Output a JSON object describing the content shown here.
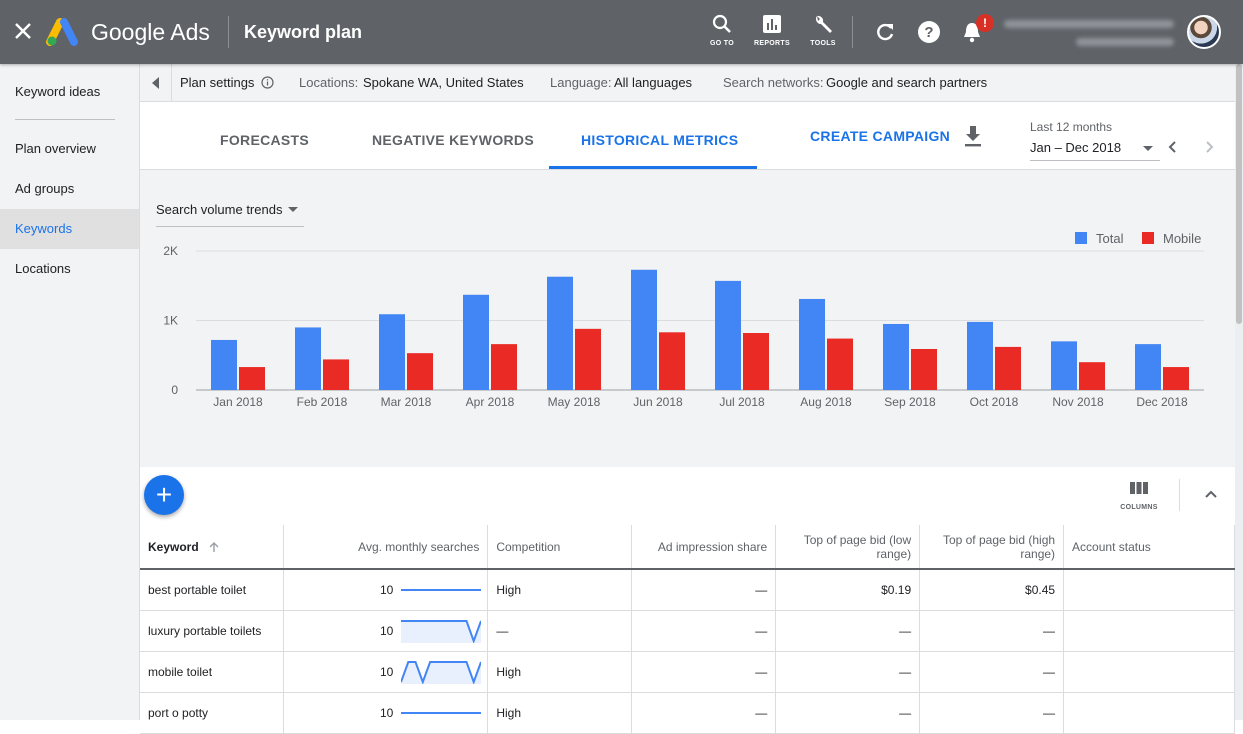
{
  "topbar": {
    "product": "Google Ads",
    "title": "Keyword plan",
    "tools": [
      {
        "icon": "search-icon",
        "label": "GO TO"
      },
      {
        "icon": "reports-icon",
        "label": "REPORTS"
      },
      {
        "icon": "wrench-icon",
        "label": "TOOLS"
      }
    ],
    "notification_badge": "!"
  },
  "sidebar": {
    "items": [
      {
        "label": "Keyword ideas",
        "active": false
      },
      {
        "label": "Plan overview",
        "active": false
      },
      {
        "label": "Ad groups",
        "active": false
      },
      {
        "label": "Keywords",
        "active": true
      },
      {
        "label": "Locations",
        "active": false
      }
    ]
  },
  "settings": {
    "label": "Plan settings",
    "locations_label": "Locations:",
    "locations_value": "Spokane WA, United States",
    "language_label": "Language:",
    "language_value": "All languages",
    "networks_label": "Search networks:",
    "networks_value": "Google and search partners"
  },
  "tabs": [
    {
      "label": "FORECASTS",
      "active": false
    },
    {
      "label": "NEGATIVE KEYWORDS",
      "active": false
    },
    {
      "label": "HISTORICAL METRICS",
      "active": true
    }
  ],
  "create_campaign": "CREATE CAMPAIGN",
  "date_range": {
    "caption": "Last 12 months",
    "value": "Jan – Dec 2018"
  },
  "trend_selector": "Search volume trends",
  "colors": {
    "total": "#4285f4",
    "mobile": "#ea2a24",
    "accent": "#1a73e8"
  },
  "chart_data": {
    "type": "bar",
    "categories": [
      "Jan 2018",
      "Feb 2018",
      "Mar 2018",
      "Apr 2018",
      "May 2018",
      "Jun 2018",
      "Jul 2018",
      "Aug 2018",
      "Sep 2018",
      "Oct 2018",
      "Nov 2018",
      "Dec 2018"
    ],
    "series": [
      {
        "name": "Total",
        "values": [
          720,
          900,
          1090,
          1370,
          1630,
          1730,
          1570,
          1310,
          950,
          980,
          700,
          660
        ]
      },
      {
        "name": "Mobile",
        "values": [
          330,
          440,
          530,
          660,
          880,
          830,
          820,
          740,
          590,
          620,
          400,
          330
        ]
      }
    ],
    "yticks": [
      "0",
      "1K",
      "2K"
    ],
    "ylim": [
      0,
      2000
    ],
    "grid": true,
    "legend": "top-right"
  },
  "table": {
    "headers": [
      "Keyword",
      "Avg. monthly searches",
      "Competition",
      "Ad impression share",
      "Top of page bid (low range)",
      "Top of page bid (high range)",
      "Account status"
    ],
    "rows": [
      {
        "keyword": "best portable toilet",
        "searches": "10",
        "trend": [
          1,
          1,
          1,
          1,
          1,
          1,
          1,
          1,
          1,
          1,
          1,
          1
        ],
        "competition": "High",
        "impression_share": "—",
        "bid_low": "$0.19",
        "bid_high": "$0.45",
        "status": ""
      },
      {
        "keyword": "luxury portable toilets",
        "searches": "10",
        "trend": [
          1,
          1,
          1,
          1,
          1,
          1,
          1,
          1,
          1,
          1,
          0,
          1
        ],
        "competition": "—",
        "impression_share": "—",
        "bid_low": "—",
        "bid_high": "—",
        "status": ""
      },
      {
        "keyword": "mobile toilet",
        "searches": "10",
        "trend": [
          0,
          1,
          1,
          0,
          1,
          1,
          1,
          1,
          1,
          1,
          0,
          1
        ],
        "competition": "High",
        "impression_share": "—",
        "bid_low": "—",
        "bid_high": "—",
        "status": ""
      },
      {
        "keyword": "port o potty",
        "searches": "10",
        "trend": [
          1,
          1,
          1,
          1,
          1,
          1,
          1,
          1,
          1,
          1,
          1,
          1
        ],
        "competition": "High",
        "impression_share": "—",
        "bid_low": "—",
        "bid_high": "—",
        "status": ""
      }
    ]
  },
  "columns_label": "COLUMNS"
}
